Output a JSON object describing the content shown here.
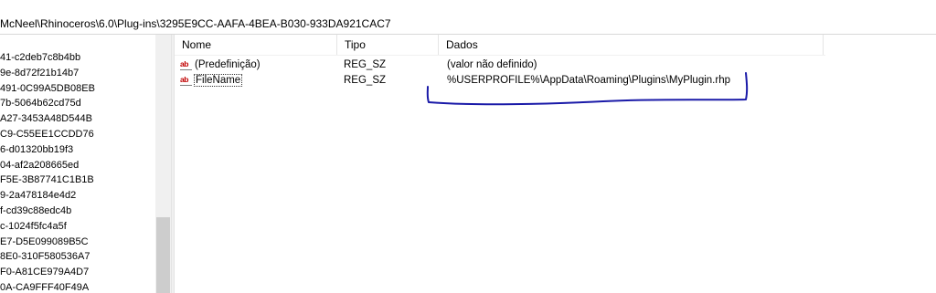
{
  "address_bar": {
    "path": "McNeel\\Rhinoceros\\6.0\\Plug-ins\\3295E9CC-AAFA-4BEA-B030-933DA921CAC7"
  },
  "tree": {
    "items": [
      "41-c2deb7c8b4bb",
      "9e-8d72f21b14b7",
      "491-0C99A5DB08EB",
      "7b-5064b62cd75d",
      "A27-3453A48D544B",
      "C9-C55EE1CCDD76",
      "6-d01320bb19f3",
      "04-af2a208665ed",
      "F5E-3B87741C1B1B",
      "9-2a478184e4d2",
      "f-cd39c88edc4b",
      "c-1024f5fc4a5f",
      "E7-D5E099089B5C",
      "8E0-310F580536A7",
      "F0-A81CE979A4D7",
      "0A-CA9FFF40F49A"
    ]
  },
  "list": {
    "columns": {
      "name": "Nome",
      "type": "Tipo",
      "data": "Dados"
    },
    "rows": [
      {
        "name": "(Predefinição)",
        "type": "REG_SZ",
        "data": "(valor não definido)",
        "icon": "string-value-icon"
      },
      {
        "name": "FileName",
        "type": "REG_SZ",
        "data": "%USERPROFILE%\\AppData\\Roaming\\Plugins\\MyPlugin.rhp",
        "icon": "string-value-icon"
      }
    ]
  },
  "icons": {
    "string_value": "ab"
  },
  "colors": {
    "icon_red": "#c00000",
    "annotation_blue": "#1a1aa8"
  }
}
